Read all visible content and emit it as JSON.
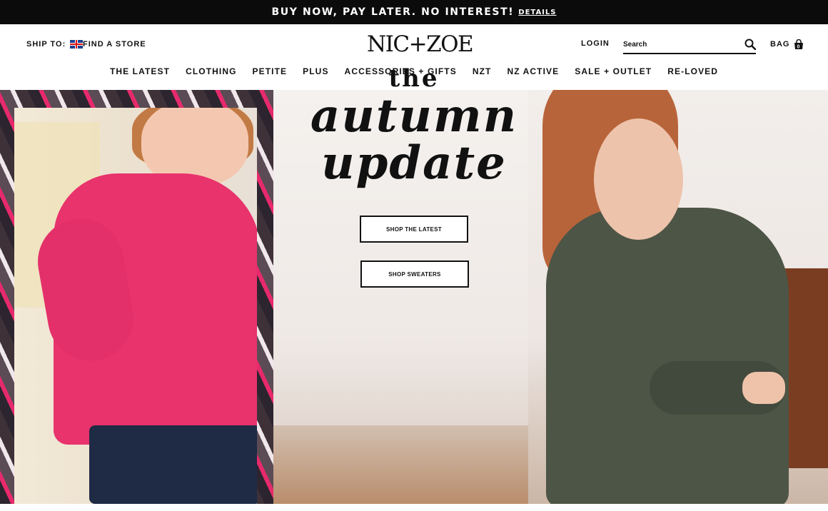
{
  "promo": {
    "text": "BUY NOW, PAY LATER. NO INTEREST!",
    "link": "DETAILS"
  },
  "header": {
    "ship_to_label": "SHIP TO:",
    "flag_icon": "uk-flag-icon",
    "find_store": "FIND A STORE",
    "logo": "NIC+ZOE",
    "login": "LOGIN",
    "search": {
      "placeholder": "Search",
      "icon": "search-icon"
    },
    "bag": {
      "label": "BAG",
      "count": "0",
      "icon": "bag-icon"
    }
  },
  "nav": {
    "items": [
      "THE LATEST",
      "CLOTHING",
      "PETITE",
      "PLUS",
      "ACCESSORIES + GIFTS",
      "NZT",
      "NZ ACTIVE",
      "SALE + OUTLET",
      "RE-LOVED"
    ]
  },
  "hero": {
    "kicker": "the",
    "title_line1": "autumn",
    "title_line2": "update",
    "cta_primary": "SHOP THE LATEST",
    "cta_secondary": "SHOP SWEATERS"
  },
  "colors": {
    "promo_bg": "#0b0b0b",
    "accent_pink": "#e8336d",
    "sweater_green": "#4d5546",
    "text": "#111111"
  }
}
